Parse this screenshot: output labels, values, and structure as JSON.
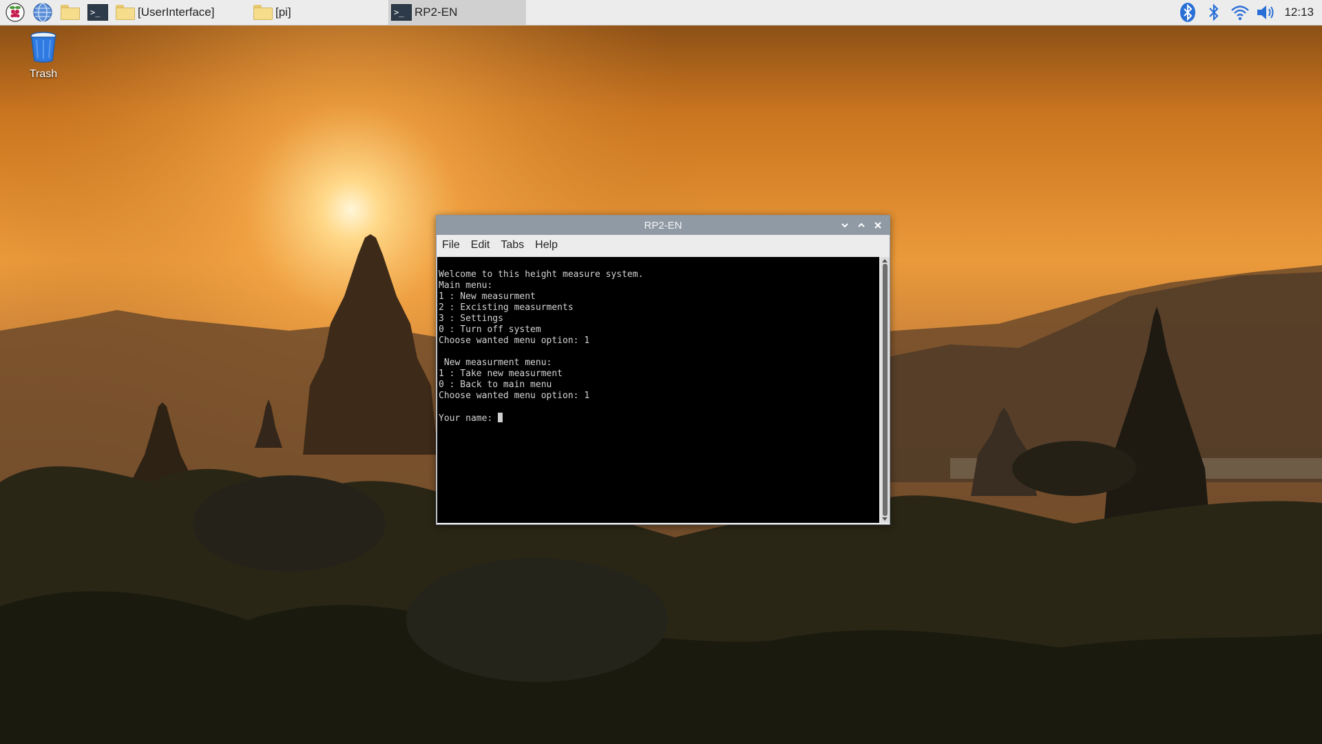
{
  "taskbar": {
    "launchers": [
      {
        "icon": "raspberry-menu-icon"
      },
      {
        "icon": "web-browser-icon"
      },
      {
        "icon": "file-manager-icon"
      },
      {
        "icon": "terminal-icon"
      }
    ],
    "tasks": [
      {
        "label": "[UserInterface]",
        "icon": "folder-icon"
      },
      {
        "label": "[pi]",
        "icon": "folder-icon"
      },
      {
        "label": "RP2-EN",
        "icon": "terminal-icon",
        "active": true
      }
    ],
    "tray": {
      "icons": [
        "bluetooth-icon",
        "bluetooth-icon",
        "wifi-icon",
        "volume-icon"
      ],
      "clock": "12:13"
    }
  },
  "desktop": {
    "trash_label": "Trash"
  },
  "window": {
    "title": "RP2-EN",
    "menu": [
      "File",
      "Edit",
      "Tabs",
      "Help"
    ],
    "terminal_lines": [
      "Welcome to this height measure system.",
      "Main menu:",
      "1 : New measurment",
      "2 : Excisting measurments",
      "3 : Settings",
      "0 : Turn off system",
      "Choose wanted menu option: 1",
      "",
      " New measurment menu:",
      "1 : Take new measurment",
      "0 : Back to main menu",
      "Choose wanted menu option: 1",
      ""
    ],
    "prompt": "Your name: "
  },
  "colors": {
    "taskbar_bg": "#ececec",
    "titlebar_bg": "#909aa5",
    "terminal_bg": "#000000",
    "terminal_fg": "#d4d4d4"
  }
}
